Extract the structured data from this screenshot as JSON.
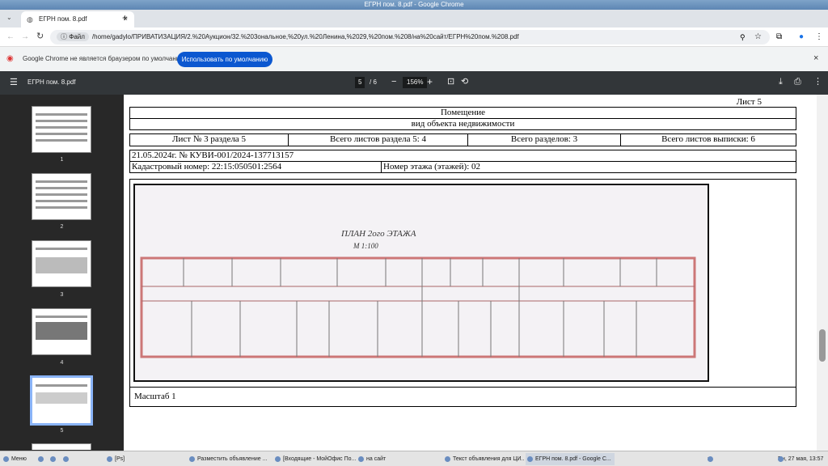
{
  "window": {
    "title": "ЕГРН пом. 8.pdf - Google Chrome"
  },
  "tab": {
    "title": "ЕГРН пом. 8.pdf",
    "close": "×",
    "new": "+"
  },
  "address": {
    "chip": "Файл",
    "url": "/home/gadylo/ПРИВАТИЗАЦИЯ/2.%20Аукцион/32.%203ональное,%20ул.%20Ленина,%2029,%20пом.%208/на%20сайт/ЕГРН%20пом.%208.pdf"
  },
  "infobar": {
    "message": "Google Chrome не является браузером по умолчанию.",
    "button": "Использовать по умолчанию",
    "close": "×"
  },
  "pdf": {
    "filename": "ЕГРН пом. 8.pdf",
    "page": "5",
    "total": "/ 6",
    "zoom": "156%"
  },
  "thumbs": [
    "1",
    "2",
    "3",
    "4",
    "5"
  ],
  "current_thumb": "5",
  "document": {
    "sheet": "Лист 5",
    "heading": "Помещение",
    "subheading": "вид объекта недвижимости",
    "row1": [
      "Лист № 3 раздела 5",
      "Всего листов раздела 5: 4",
      "Всего разделов: 3",
      "Всего листов выписки: 6"
    ],
    "date_no": "21.05.2024г. № КУВИ-001/2024-137713157",
    "cadastral": "Кадастровый номер: 22:15:050501:2564",
    "floor": "Номер этажа (этажей): 02",
    "plan_title": "ПЛАН 2ого ЭТАЖА",
    "plan_scale": "М 1:100",
    "scale": "Масштаб 1"
  },
  "taskbar": {
    "menu": "Меню",
    "items": [
      "[Ps]",
      "Разместить объявление ...",
      "[Входящие - МойОфис По...",
      "на сайт",
      "Текст объявления для ЦИ...",
      "ЕГРН пом. 8.pdf - Google C..."
    ],
    "lang": "ru",
    "clock": "Пн, 27 мая, 13:57"
  }
}
